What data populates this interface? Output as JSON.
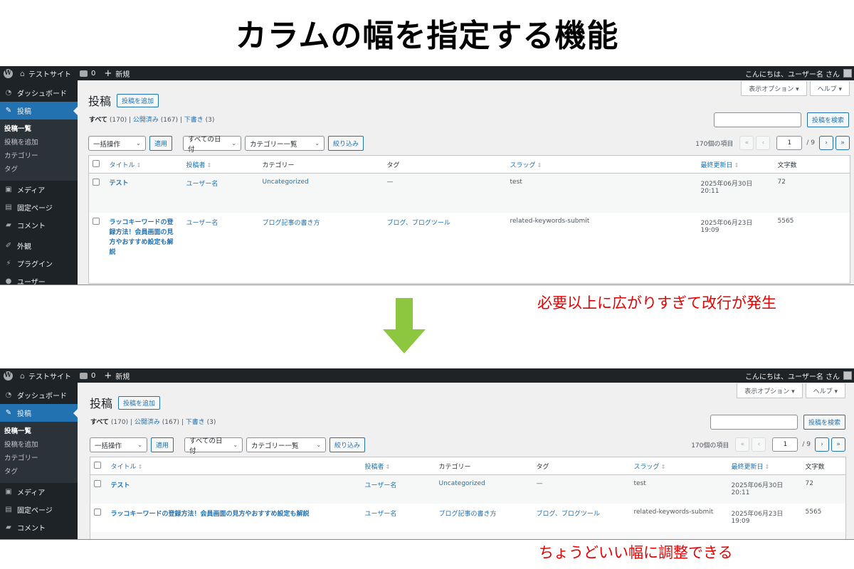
{
  "heading": "カラムの幅を指定する機能",
  "wp": {
    "adminbar": {
      "site_name": "テストサイト",
      "comments_count": "0",
      "new_label": "新規",
      "greeting": "こんにちは、ユーザー名 さん"
    },
    "menu": {
      "dashboard": "ダッシュボード",
      "posts": "投稿",
      "sub_all_posts": "投稿一覧",
      "sub_add_post": "投稿を追加",
      "sub_categories": "カテゴリー",
      "sub_tags": "タグ",
      "media": "メディア",
      "pages": "固定ページ",
      "comments": "コメント",
      "appearance": "外観",
      "plugins": "プラグイン",
      "users": "ユーザー"
    },
    "screen_options": "表示オプション ▾",
    "help": "ヘルプ ▾",
    "page_title": "投稿",
    "add_new": "投稿を追加",
    "views": {
      "all": "すべて",
      "all_count": "(170)",
      "published": "公開済み",
      "published_count": "(167)",
      "drafts": "下書き",
      "drafts_count": "(3)"
    },
    "search_button": "投稿を検索",
    "bulk_action": "一括操作",
    "apply": "適用",
    "all_dates": "すべての日付",
    "category_filter": "カテゴリー一覧",
    "filter_button": "絞り込み",
    "items_count": "170個の項目",
    "pager": {
      "first": "«",
      "prev": "‹",
      "current": "1",
      "total": "/ 9",
      "next": "›",
      "last": "»"
    },
    "columns": {
      "title": "タイトル",
      "author": "投稿者",
      "categories": "カテゴリー",
      "tags": "タグ",
      "slug": "スラッグ",
      "modified": "最終更新日",
      "word_count": "文字数"
    },
    "rows": [
      {
        "title": "テスト",
        "author": "ユーザー名",
        "category": "Uncategorized",
        "tags": "—",
        "slug": "test",
        "modified": "2025年06月30日 20:11",
        "words": "72"
      },
      {
        "title": "ラッコキーワードの登録方法！会員画面の見方やおすすめ設定も解説",
        "author": "ユーザー名",
        "category": "ブログ記事の書き方",
        "tags": "ブログ、ブログツール",
        "slug": "related-keywords-submit",
        "modified": "2025年06月23日 19:09",
        "words": "5565"
      }
    ]
  },
  "notes": {
    "before": "必要以上に広がりすぎて改行が発生",
    "after": "ちょうどいい幅に調整できる"
  },
  "colors": {
    "note": "#e60000",
    "arrow": "#8dc63f",
    "wp_blue": "#2271b1",
    "admin_dark": "#1d2327"
  }
}
